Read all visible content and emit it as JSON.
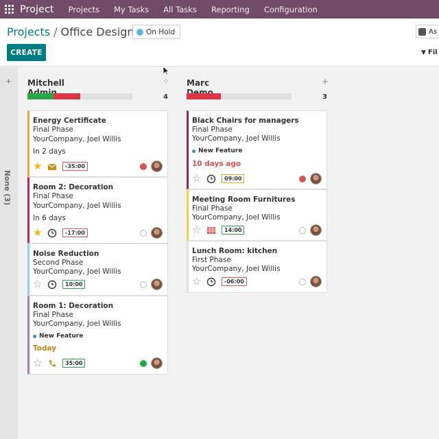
{
  "navbar": {
    "brand": "Project",
    "items": [
      "Projects",
      "My Tasks",
      "All Tasks",
      "Reporting",
      "Configuration"
    ]
  },
  "breadcrumb": {
    "parent": "Projects",
    "separator": "/",
    "current": "Office Design"
  },
  "status": {
    "label": "On Hold",
    "color": "#5bb5e0"
  },
  "buttons": {
    "create": "CREATE"
  },
  "right_widget": {
    "label": "As"
  },
  "filter": {
    "label": "Fil"
  },
  "folded_column": {
    "label": "None (3)",
    "plus": "+"
  },
  "columns": [
    {
      "title": "Mitchell Admin",
      "count": "4",
      "progress": {
        "green": 0.25,
        "red": 0.25
      },
      "cards": [
        {
          "title": "Energy Certificate",
          "stage": "Final Phase",
          "customer": "YourCompany, Joel Willis",
          "date": "In 2 days",
          "starred": true,
          "activity_icon": "envelope-icon",
          "time": "-35:00",
          "time_color": "red",
          "kanban_state": "red",
          "color": "#f0a23a"
        },
        {
          "title": "Room 2: Decoration",
          "stage": "Final Phase",
          "customer": "YourCompany, Joel Willis",
          "date": "In 6 days",
          "starred": true,
          "activity_icon": "clock-icon",
          "time": "-17:00",
          "time_color": "red",
          "kanban_state": "grey",
          "color": "#c2255c"
        },
        {
          "title": "Noise Reduction",
          "stage": "Second Phase",
          "customer": "YourCompany, Joel Willis",
          "starred": false,
          "activity_icon": "clock-icon",
          "time": "10:00",
          "time_color": "green",
          "kanban_state": "grey",
          "color": "#8fd0ea"
        },
        {
          "title": "Room 1: Decoration",
          "stage": "Final Phase",
          "customer": "YourCompany, Joel Willis",
          "tag": "New Feature",
          "date": "Today",
          "starred": false,
          "activity_icon": "phone-icon",
          "time": "35:00",
          "time_color": "green",
          "kanban_state": "green",
          "color": "#a77bc9"
        }
      ]
    },
    {
      "title": "Marc Demo",
      "count": "3",
      "plus": "+",
      "progress": {
        "green": 0,
        "red": 0.33
      },
      "cards": [
        {
          "title": "Black Chairs for managers",
          "stage": "Final Phase",
          "customer": "YourCompany, Joel Willis",
          "tag": "New Feature",
          "date": "10 days ago",
          "starred": false,
          "activity_icon": "clock-icon",
          "time": "09:00",
          "time_color": "orange",
          "kanban_state": "red",
          "color": "#8a2a57"
        },
        {
          "title": "Meeting Room Furnitures",
          "stage": "Final Phase",
          "customer": "YourCompany, Joel Willis",
          "starred": false,
          "activity_icon": "sheet-icon",
          "time": "14:00",
          "time_color": "green",
          "kanban_state": "grey",
          "color": "#f5d142"
        },
        {
          "title": "Lunch Room: kitchen",
          "stage": "First Phase",
          "customer": "YourCompany, Joel Willis",
          "starred": false,
          "activity_icon": "clock-icon",
          "time": "-06:00",
          "time_color": "red",
          "kanban_state": "grey",
          "color": "#dddddd"
        }
      ]
    }
  ]
}
